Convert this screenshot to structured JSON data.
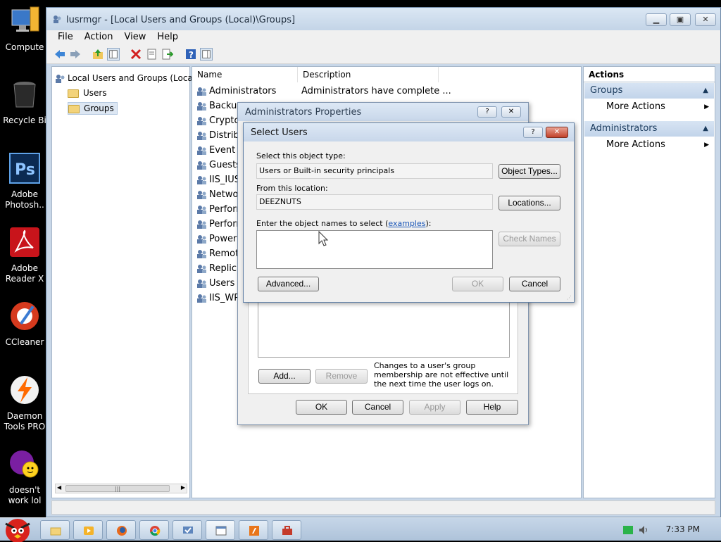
{
  "desktop": {
    "icons": [
      {
        "label": "Compute",
        "icon": "computer-icon"
      },
      {
        "label": "Recycle Bi",
        "icon": "recycle-bin-icon"
      },
      {
        "label": "Adobe\nPhotosh..",
        "icon": "photoshop-icon",
        "badge": "Ps"
      },
      {
        "label": "Adobe\nReader X",
        "icon": "adobe-reader-icon"
      },
      {
        "label": "CCleaner",
        "icon": "ccleaner-icon"
      },
      {
        "label": "Daemon\nTools PRO",
        "icon": "daemon-tools-icon"
      },
      {
        "label": "doesn't\nwork lol",
        "icon": "yahoo-messenger-icon"
      }
    ]
  },
  "window": {
    "title": "lusrmgr - [Local Users and Groups (Local)\\Groups]",
    "menu": [
      "File",
      "Action",
      "View",
      "Help"
    ]
  },
  "tree": {
    "root": "Local Users and Groups (Loca",
    "items": [
      "Users",
      "Groups"
    ]
  },
  "list": {
    "columns": [
      "Name",
      "Description"
    ],
    "rows": [
      {
        "name": "Administrators",
        "description": "Administrators have complete ..."
      },
      {
        "name": "Backup",
        "description": ""
      },
      {
        "name": "Cryptog",
        "description": ""
      },
      {
        "name": "Distribu",
        "description": ""
      },
      {
        "name": "Event L",
        "description": ""
      },
      {
        "name": "Guests",
        "description": ""
      },
      {
        "name": "IIS_IUS",
        "description": ""
      },
      {
        "name": "Networ",
        "description": ""
      },
      {
        "name": "Perform",
        "description": ""
      },
      {
        "name": "Perform",
        "description": ""
      },
      {
        "name": "Power U",
        "description": ""
      },
      {
        "name": "Remote",
        "description": ""
      },
      {
        "name": "Replica",
        "description": ""
      },
      {
        "name": "Users",
        "description": ""
      },
      {
        "name": "IIS_WP",
        "description": ""
      }
    ]
  },
  "actions": {
    "title": "Actions",
    "sections": [
      {
        "label": "Groups",
        "item": "More Actions"
      },
      {
        "label": "Administrators",
        "item": "More Actions"
      }
    ]
  },
  "admin_dialog": {
    "title": "Administrators Properties",
    "note": "Changes to a user's group membership are not effective until the next time the user logs on.",
    "add": "Add...",
    "remove": "Remove",
    "ok": "OK",
    "cancel": "Cancel",
    "apply": "Apply",
    "help": "Help"
  },
  "select_dialog": {
    "title": "Select Users",
    "object_type_label": "Select this object type:",
    "object_type_value": "Users or Built-in security principals",
    "object_types_button": "Object Types...",
    "location_label": "From this location:",
    "location_value": "DEEZNUTS",
    "locations_button": "Locations...",
    "names_label_prefix": "Enter the object names to select (",
    "names_label_link": "examples",
    "names_label_suffix": "):",
    "check_names": "Check Names",
    "advanced": "Advanced...",
    "ok": "OK",
    "cancel": "Cancel"
  },
  "taskbar": {
    "clock": "7:33 PM",
    "items": [
      "folder-icon",
      "media-player-icon",
      "firefox-icon",
      "chrome-icon",
      "computer-management-icon",
      "lusrmgr-icon",
      "adobe-flash-icon",
      "toolbox-icon"
    ]
  }
}
